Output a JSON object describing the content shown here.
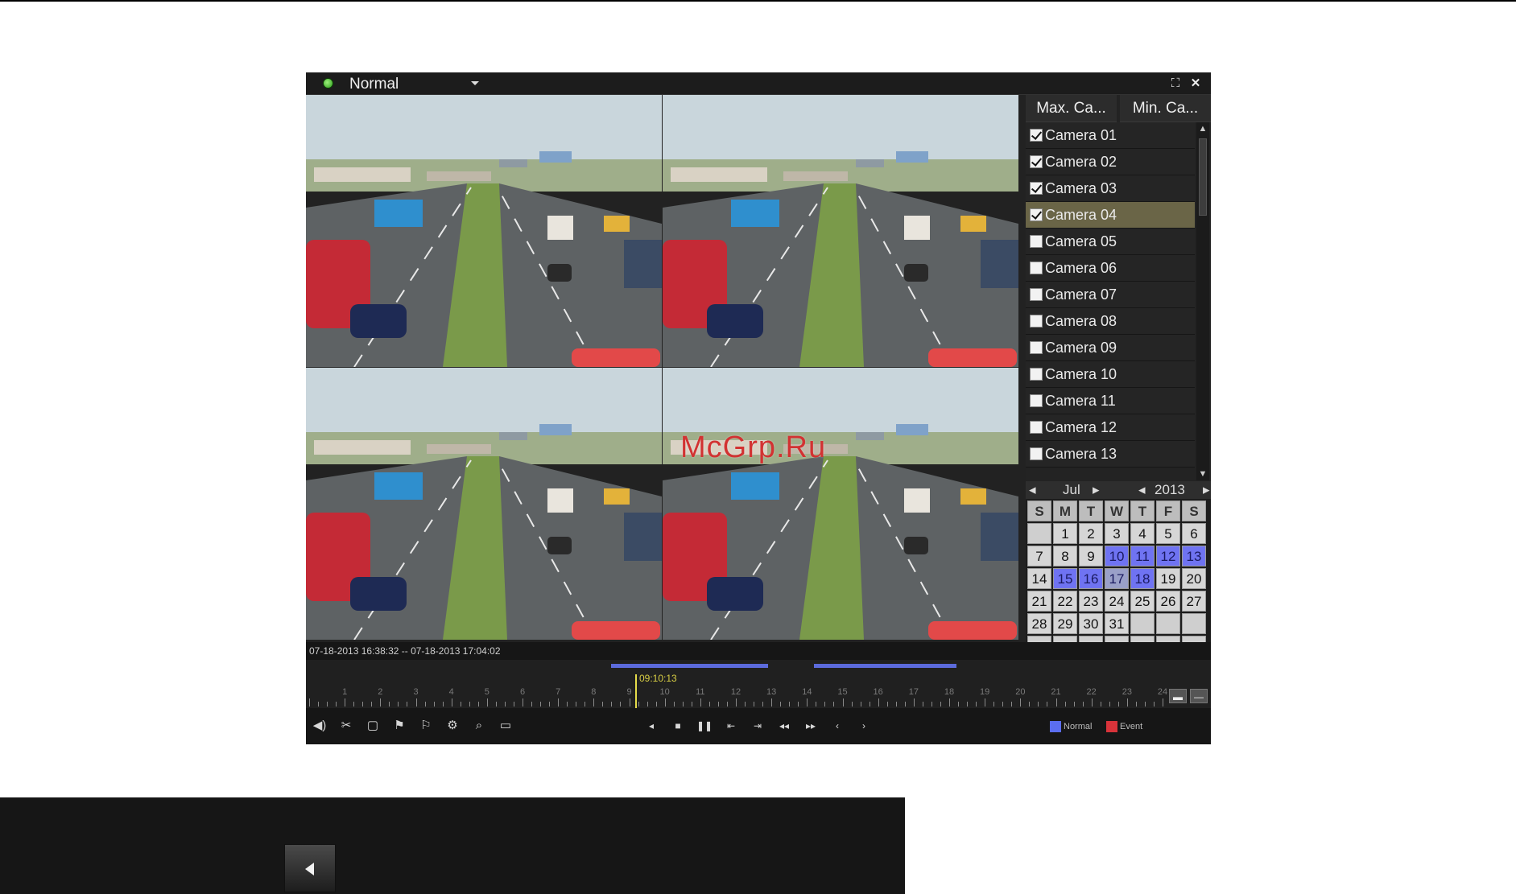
{
  "titlebar": {
    "mode": "Normal",
    "fullscreen_icon": "fullscreen-icon",
    "close_icon": "close-icon"
  },
  "panel": {
    "tabs": [
      "Max. Ca...",
      "Min. Ca..."
    ],
    "cameras": [
      {
        "label": "Camera 01",
        "checked": true
      },
      {
        "label": "Camera 02",
        "checked": true
      },
      {
        "label": "Camera 03",
        "checked": true
      },
      {
        "label": "Camera 04",
        "checked": true,
        "selected": true
      },
      {
        "label": "Camera 05",
        "checked": false
      },
      {
        "label": "Camera 06",
        "checked": false
      },
      {
        "label": "Camera 07",
        "checked": false
      },
      {
        "label": "Camera 08",
        "checked": false
      },
      {
        "label": "Camera 09",
        "checked": false
      },
      {
        "label": "Camera 10",
        "checked": false
      },
      {
        "label": "Camera 11",
        "checked": false
      },
      {
        "label": "Camera 12",
        "checked": false
      },
      {
        "label": "Camera 13",
        "checked": false
      }
    ]
  },
  "calendar": {
    "month": "Jul",
    "year": "2013",
    "weekdays": [
      "S",
      "M",
      "T",
      "W",
      "T",
      "F",
      "S"
    ],
    "weeks": [
      [
        "",
        "1",
        "2",
        "3",
        "4",
        "5",
        "6"
      ],
      [
        "7",
        "8",
        "9",
        "10",
        "11",
        "12",
        "13"
      ],
      [
        "14",
        "15",
        "16",
        "17",
        "18",
        "19",
        "20"
      ],
      [
        "21",
        "22",
        "23",
        "24",
        "25",
        "26",
        "27"
      ],
      [
        "28",
        "29",
        "30",
        "31",
        "",
        "",
        ""
      ],
      [
        "",
        "",
        "",
        "",
        "",
        "",
        ""
      ]
    ],
    "recorded_days": [
      "10",
      "11",
      "12",
      "13",
      "15",
      "16",
      "17",
      "18"
    ],
    "selected_day": "17"
  },
  "timeline": {
    "range_text": "07-18-2013 16:38:32 -- 07-18-2013 17:04:02",
    "cursor_time": "09:10:13",
    "hours": [
      "1",
      "2",
      "3",
      "4",
      "5",
      "6",
      "7",
      "8",
      "9",
      "10",
      "11",
      "12",
      "13",
      "14",
      "15",
      "16",
      "17",
      "18",
      "19",
      "20",
      "21",
      "22",
      "23",
      "24"
    ],
    "cursor_hour": 9.17,
    "record_segments": [
      {
        "start_hour": 8.5,
        "end_hour": 12.9
      },
      {
        "start_hour": 14.2,
        "end_hour": 18.2
      }
    ],
    "zoom_in_icon": "zoom-in-icon",
    "zoom_out_icon": "zoom-out-icon"
  },
  "toolbar": {
    "left_tools": [
      "audio-icon",
      "clip-icon",
      "lock-icon",
      "tag-icon",
      "add-tag-icon",
      "settings-icon",
      "search-icon",
      "more-icon"
    ],
    "playback_tools": [
      "reverse-play-icon",
      "stop-icon",
      "pause-icon",
      "step-back-icon",
      "step-forward-icon",
      "slow-icon",
      "fast-icon",
      "prev-icon",
      "next-icon"
    ],
    "legend": [
      {
        "label": "Normal",
        "color": "#5b6ef0"
      },
      {
        "label": "Event",
        "color": "#d8333a"
      }
    ]
  },
  "watermark": "McGrp.Ru",
  "back_button_icon": "back-arrow-icon"
}
